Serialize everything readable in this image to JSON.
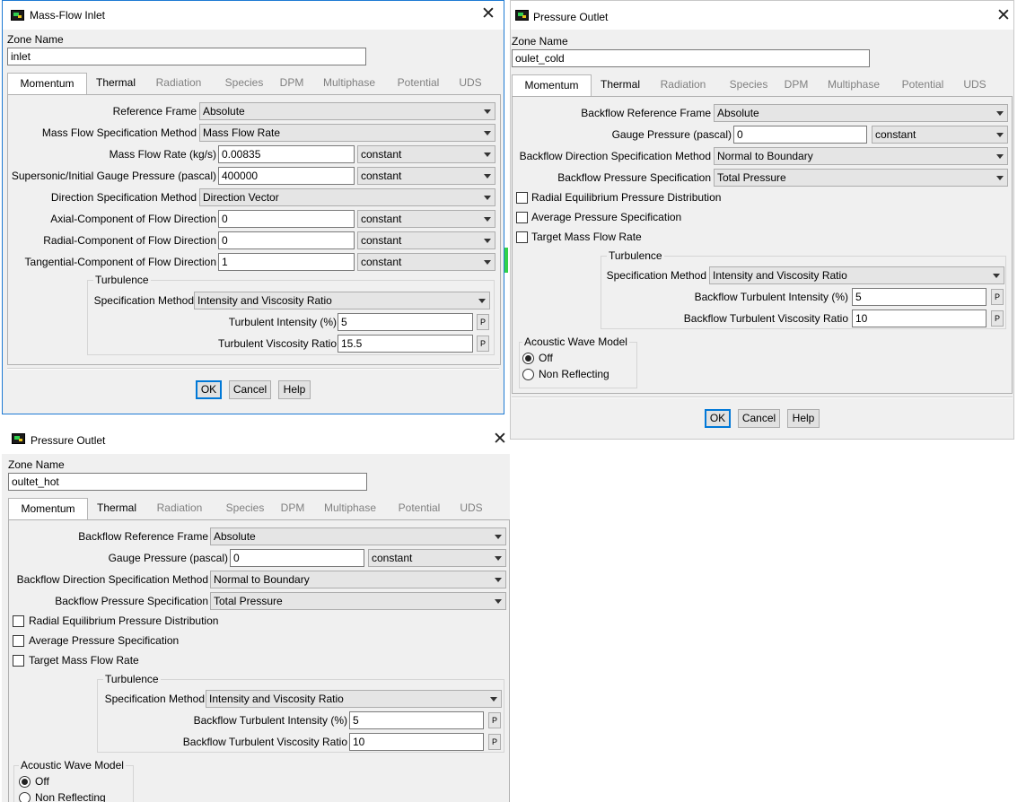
{
  "zone_name_label": "Zone Name",
  "tabs": [
    "Momentum",
    "Thermal",
    "Radiation",
    "Species",
    "DPM",
    "Multiphase",
    "Potential",
    "UDS"
  ],
  "buttons": {
    "ok": "OK",
    "cancel": "Cancel",
    "help": "Help"
  },
  "p_label": "P",
  "inlet": {
    "title": "Mass-Flow Inlet",
    "zone_name": "inlet",
    "reference_frame": {
      "label": "Reference Frame",
      "value": "Absolute"
    },
    "mass_flow_spec": {
      "label": "Mass Flow Specification Method",
      "value": "Mass Flow Rate"
    },
    "mass_flow_rate": {
      "label": "Mass Flow Rate (kg/s)",
      "value": "0.00835",
      "method": "constant"
    },
    "gauge_pressure": {
      "label": "Supersonic/Initial Gauge Pressure (pascal)",
      "value": "400000",
      "method": "constant"
    },
    "direction_spec": {
      "label": "Direction Specification Method",
      "value": "Direction Vector"
    },
    "axial": {
      "label": "Axial-Component of Flow Direction",
      "value": "0",
      "method": "constant"
    },
    "radial": {
      "label": "Radial-Component of Flow Direction",
      "value": "0",
      "method": "constant"
    },
    "tangential": {
      "label": "Tangential-Component of Flow Direction",
      "value": "1",
      "method": "constant"
    },
    "turbulence": {
      "title": "Turbulence",
      "spec_label": "Specification Method",
      "spec_value": "Intensity and Viscosity Ratio",
      "intensity_label": "Turbulent Intensity (%)",
      "intensity_value": "5",
      "viscosity_label": "Turbulent Viscosity Ratio",
      "viscosity_value": "15.5"
    }
  },
  "outlet_cold": {
    "title": "Pressure Outlet",
    "zone_name": "oulet_cold",
    "backflow_ref": {
      "label": "Backflow Reference Frame",
      "value": "Absolute"
    },
    "gauge": {
      "label": "Gauge Pressure (pascal)",
      "value": "0",
      "method": "constant"
    },
    "backflow_dir": {
      "label": "Backflow Direction Specification Method",
      "value": "Normal to Boundary"
    },
    "backflow_press": {
      "label": "Backflow Pressure Specification",
      "value": "Total Pressure"
    },
    "checks": [
      "Radial Equilibrium Pressure Distribution",
      "Average Pressure Specification",
      "Target Mass Flow Rate"
    ],
    "turbulence": {
      "title": "Turbulence",
      "spec_label": "Specification Method",
      "spec_value": "Intensity and Viscosity Ratio",
      "intensity_label": "Backflow Turbulent Intensity (%)",
      "intensity_value": "5",
      "viscosity_label": "Backflow Turbulent Viscosity Ratio",
      "viscosity_value": "10"
    },
    "acoustic": {
      "title": "Acoustic Wave Model",
      "off": "Off",
      "non_reflecting": "Non Reflecting"
    }
  },
  "outlet_hot": {
    "title": "Pressure Outlet",
    "zone_name": "oultet_hot",
    "backflow_ref": {
      "label": "Backflow Reference Frame",
      "value": "Absolute"
    },
    "gauge": {
      "label": "Gauge Pressure (pascal)",
      "value": "0",
      "method": "constant"
    },
    "backflow_dir": {
      "label": "Backflow Direction Specification Method",
      "value": "Normal to Boundary"
    },
    "backflow_press": {
      "label": "Backflow Pressure Specification",
      "value": "Total Pressure"
    },
    "checks": [
      "Radial Equilibrium Pressure Distribution",
      "Average Pressure Specification",
      "Target Mass Flow Rate"
    ],
    "turbulence": {
      "title": "Turbulence",
      "spec_label": "Specification Method",
      "spec_value": "Intensity and Viscosity Ratio",
      "intensity_label": "Backflow Turbulent Intensity (%)",
      "intensity_value": "5",
      "viscosity_label": "Backflow Turbulent Viscosity Ratio",
      "viscosity_value": "10"
    },
    "acoustic": {
      "title": "Acoustic Wave Model",
      "off": "Off",
      "non_reflecting": "Non Reflecting"
    }
  }
}
